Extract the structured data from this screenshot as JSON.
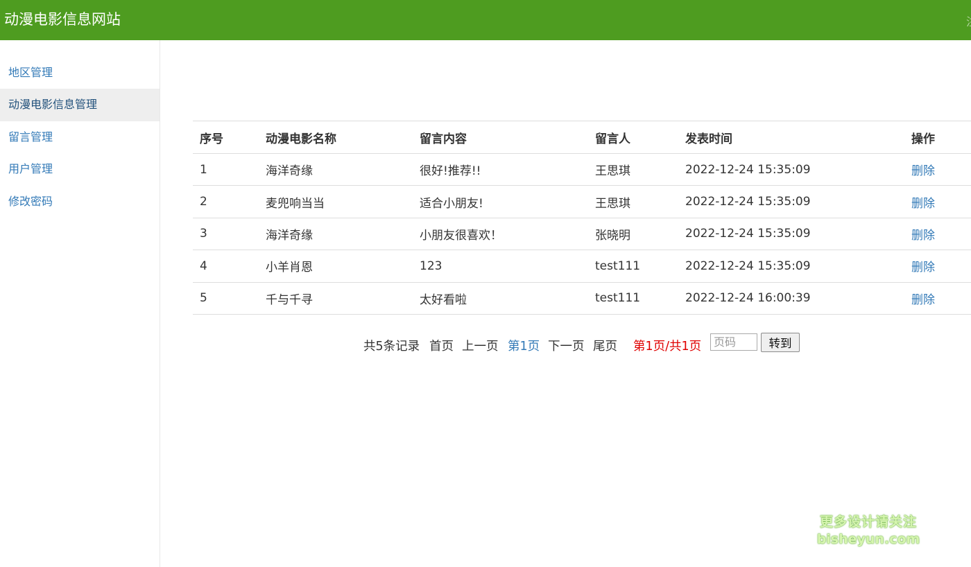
{
  "header": {
    "title": "动漫电影信息网站",
    "cut_text": "注"
  },
  "sidebar": {
    "items": [
      {
        "label": "地区管理",
        "active": false
      },
      {
        "label": "动漫电影信息管理",
        "active": true
      },
      {
        "label": "留言管理",
        "active": false
      },
      {
        "label": "用户管理",
        "active": false
      },
      {
        "label": "修改密码",
        "active": false
      }
    ]
  },
  "table": {
    "columns": [
      "序号",
      "动漫电影名称",
      "留言内容",
      "留言人",
      "发表时间",
      "操作"
    ],
    "rows": [
      {
        "index": "1",
        "movie": "海洋奇缘",
        "content": "很好!推荐!!",
        "author": "王思琪",
        "time": "2022-12-24 15:35:09",
        "action": "删除"
      },
      {
        "index": "2",
        "movie": "麦兜响当当",
        "content": "适合小朋友!",
        "author": "王思琪",
        "time": "2022-12-24 15:35:09",
        "action": "删除"
      },
      {
        "index": "3",
        "movie": "海洋奇缘",
        "content": "小朋友很喜欢！",
        "author": "张晓明",
        "time": "2022-12-24 15:35:09",
        "action": "删除"
      },
      {
        "index": "4",
        "movie": "小羊肖恩",
        "content": "123",
        "author": "test111",
        "time": "2022-12-24 15:35:09",
        "action": "删除"
      },
      {
        "index": "5",
        "movie": "千与千寻",
        "content": "太好看啦",
        "author": "test111",
        "time": "2022-12-24 16:00:39",
        "action": "删除"
      }
    ]
  },
  "pager": {
    "total": "共5条记录",
    "first": "首页",
    "prev": "上一页",
    "current": "第1页",
    "next": "下一页",
    "last": "尾页",
    "page_info": "第1页/共1页",
    "page_input_placeholder": "页码",
    "go_label": "转到"
  },
  "watermark": {
    "line1": "更多设计请关注",
    "line2": "bisheyun.com"
  },
  "colors": {
    "header_bg": "#4e9c20",
    "link": "#337ab7",
    "page_info": "#e00000",
    "active_item_bg": "#eeeeee"
  }
}
